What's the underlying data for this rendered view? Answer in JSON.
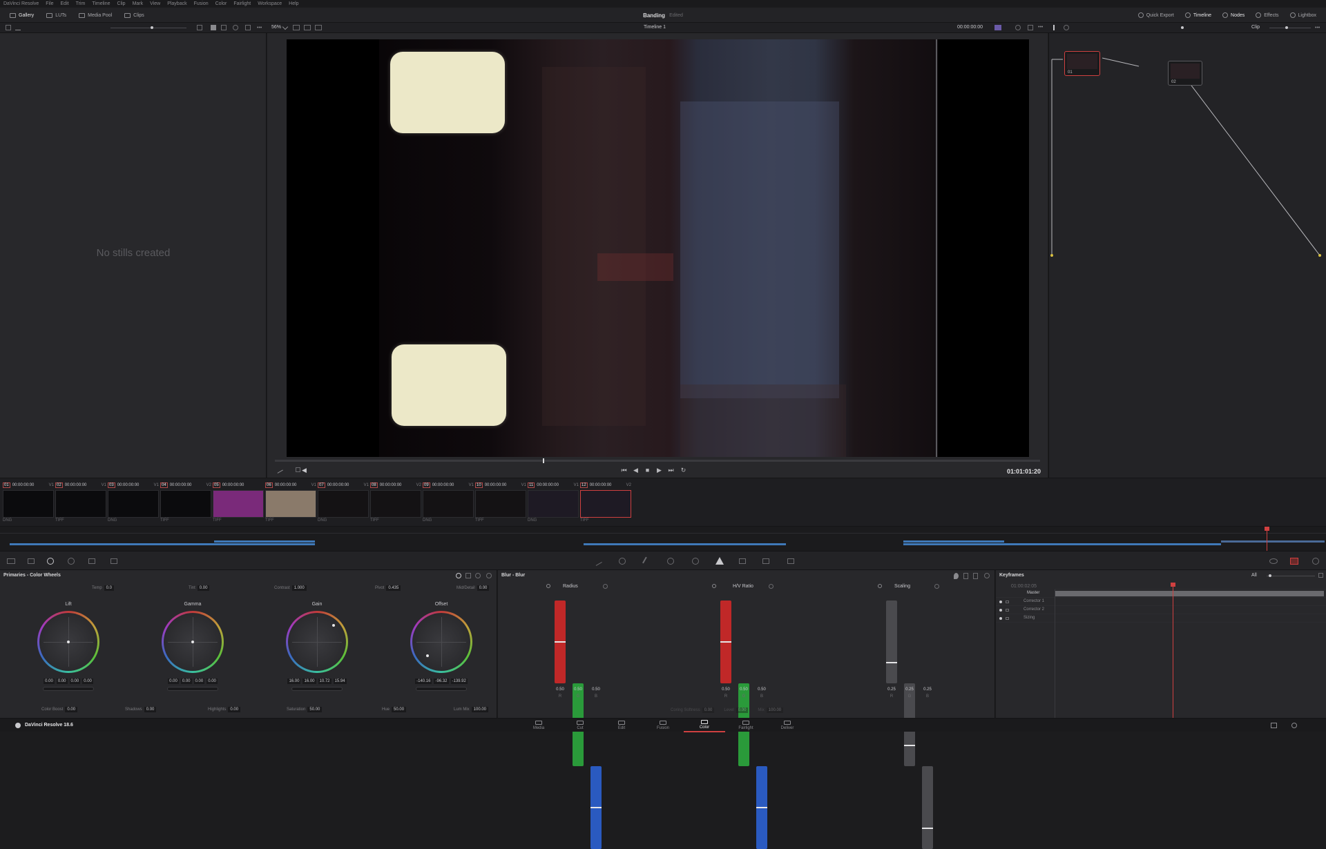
{
  "menu": [
    "DaVinci Resolve",
    "File",
    "Edit",
    "Trim",
    "Timeline",
    "Clip",
    "Mark",
    "View",
    "Playback",
    "Fusion",
    "Color",
    "Fairlight",
    "Workspace",
    "Help"
  ],
  "topbar": {
    "left": [
      {
        "label": "Gallery",
        "icon": "gallery-icon",
        "active": true
      },
      {
        "label": "LUTs",
        "icon": "luts-icon"
      },
      {
        "label": "Media Pool",
        "icon": "media-pool-icon"
      },
      {
        "label": "Clips",
        "icon": "clips-icon"
      }
    ],
    "project_title": "Banding",
    "project_status": "Edited",
    "right": [
      {
        "label": "Quick Export",
        "icon": "quick-export-icon"
      },
      {
        "label": "Timeline",
        "icon": "timeline-icon",
        "active": true
      },
      {
        "label": "Nodes",
        "icon": "nodes-icon",
        "active": true
      },
      {
        "label": "Effects",
        "icon": "effects-icon"
      },
      {
        "label": "Lightbox",
        "icon": "lightbox-icon"
      }
    ]
  },
  "subbar": {
    "zoom": "56%",
    "timeline_name": "Timeline 1",
    "timecode": "00:00:00:00",
    "clip_mode": "Clip"
  },
  "gallery": {
    "empty_text": "No stills created"
  },
  "viewer": {
    "timecode": "01:01:01:20",
    "playhead": 0.35
  },
  "nodes": [
    {
      "label": "01"
    },
    {
      "label": "02"
    }
  ],
  "clips": [
    {
      "num": "01",
      "tc": "00:00:00:00",
      "track": "V1",
      "format": "DNG",
      "thumb": "#0b0b0d"
    },
    {
      "num": "02",
      "tc": "00:00:00:00",
      "track": "V1",
      "format": "TIFF",
      "thumb": "#0b0b0d"
    },
    {
      "num": "03",
      "tc": "00:00:00:00",
      "track": "V1",
      "format": "DNG",
      "thumb": "#0b0b0d"
    },
    {
      "num": "04",
      "tc": "00:00:00:00",
      "track": "V2",
      "format": "TIFF",
      "thumb": "#0b0b0d"
    },
    {
      "num": "05",
      "tc": "00:00:00:00",
      "track": "",
      "format": "TIFF",
      "thumb": "#7a2a7a"
    },
    {
      "num": "06",
      "tc": "00:00:00:00",
      "track": "V1",
      "format": "TIFF",
      "thumb": "#8a7a6a"
    },
    {
      "num": "07",
      "tc": "00:00:00:00",
      "track": "V1",
      "format": "DNG",
      "thumb": "#141214"
    },
    {
      "num": "08",
      "tc": "00:00:00:00",
      "track": "V2",
      "format": "TIFF",
      "thumb": "#141214"
    },
    {
      "num": "09",
      "tc": "00:00:00:00",
      "track": "V1",
      "format": "DNG",
      "thumb": "#141214"
    },
    {
      "num": "10",
      "tc": "00:00:00:00",
      "track": "V1",
      "format": "TIFF",
      "thumb": "#141214"
    },
    {
      "num": "11",
      "tc": "00:00:00:00",
      "track": "V1",
      "format": "DNG",
      "thumb": "#1e1a24"
    },
    {
      "num": "12",
      "tc": "00:00:00:00",
      "track": "V2",
      "format": "TIFF",
      "thumb": "#1e1a24",
      "selected": true
    }
  ],
  "primaries": {
    "title": "Primaries - Color Wheels",
    "top_params": [
      {
        "name": "Temp",
        "value": "0.0"
      },
      {
        "name": "Tint",
        "value": "0.00"
      },
      {
        "name": "Contrast",
        "value": "1.000"
      },
      {
        "name": "Pivot",
        "value": "0.435"
      },
      {
        "name": "Mid/Detail",
        "value": "0.00"
      }
    ],
    "wheels": [
      {
        "name": "Lift",
        "values": [
          "0.00",
          "0.00",
          "0.00",
          "0.00"
        ],
        "dot": [
          0.5,
          0.5
        ]
      },
      {
        "name": "Gamma",
        "values": [
          "0.00",
          "0.00",
          "0.00",
          "0.00"
        ],
        "dot": [
          0.5,
          0.5
        ]
      },
      {
        "name": "Gain",
        "values": [
          "16.00",
          "16.00",
          "10.72",
          "15.94"
        ],
        "dot": [
          0.78,
          0.22
        ]
      },
      {
        "name": "Offset",
        "values": [
          "-140.16",
          "-96.32",
          "-139.92",
          ""
        ],
        "dot": [
          0.26,
          0.74
        ]
      }
    ],
    "bottom_params": [
      {
        "name": "Color Boost",
        "value": "0.00"
      },
      {
        "name": "Shadows",
        "value": "0.00"
      },
      {
        "name": "Highlights",
        "value": "0.00"
      },
      {
        "name": "Saturation",
        "value": "50.00"
      },
      {
        "name": "Hue",
        "value": "50.00"
      },
      {
        "name": "Lum Mix",
        "value": "100.00"
      }
    ]
  },
  "blur": {
    "title": "Blur - Blur",
    "groups": [
      {
        "name": "Radius",
        "values": [
          "0.50",
          "0.50",
          "0.50"
        ],
        "level": 0.5
      },
      {
        "name": "H/V Ratio",
        "values": [
          "0.50",
          "0.50",
          "0.50"
        ],
        "level": 0.5
      },
      {
        "name": "Scaling",
        "values": [
          "0.25",
          "0.25",
          "0.25"
        ],
        "level": 0.25
      }
    ],
    "channels": [
      "R",
      "G",
      "B"
    ],
    "bottom_params": [
      {
        "name": "Coring Softness",
        "value": "0.00"
      },
      {
        "name": "Level",
        "value": "0.00"
      },
      {
        "name": "Mix",
        "value": "100.00"
      }
    ]
  },
  "keyframes": {
    "title": "Keyframes",
    "filter": "All",
    "timecode": "01:00:02:05",
    "rows": [
      "Master",
      "Corrector 1",
      "Corrector 2",
      "Sizing"
    ]
  },
  "pages": [
    {
      "label": "Media"
    },
    {
      "label": "Cut"
    },
    {
      "label": "Edit"
    },
    {
      "label": "Fusion"
    },
    {
      "label": "Color",
      "active": true
    },
    {
      "label": "Fairlight"
    },
    {
      "label": "Deliver"
    }
  ],
  "app_name": "DaVinci Resolve 18.6",
  "colors": {
    "accent": "#d04040",
    "track_blue": "#3f79b8"
  }
}
